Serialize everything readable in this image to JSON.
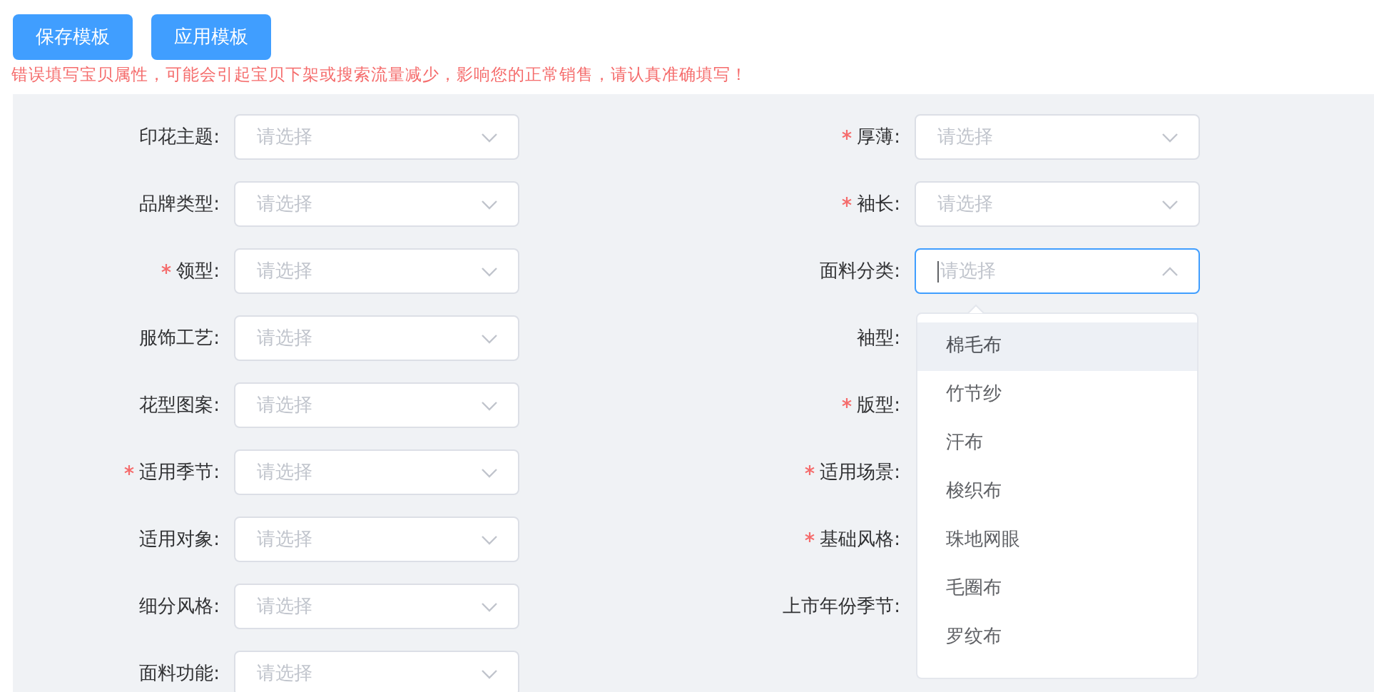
{
  "buttons": [
    "保存模板",
    "应用模板"
  ],
  "warning": "错误填写宝贝属性，可能会引起宝贝下架或搜索流量减少，影响您的正常销售，请认真准确填写！",
  "rows": [
    {
      "left": {
        "label": "印花主题:",
        "required": false,
        "placeholder": "请选择",
        "open": false
      },
      "right": {
        "label": "厚薄:",
        "required": true,
        "placeholder": "请选择",
        "open": false
      }
    },
    {
      "left": {
        "label": "品牌类型:",
        "required": false,
        "placeholder": "请选择",
        "open": false
      },
      "right": {
        "label": "袖长:",
        "required": true,
        "placeholder": "请选择",
        "open": false
      }
    },
    {
      "left": {
        "label": "领型:",
        "required": true,
        "placeholder": "请选择",
        "open": false
      },
      "right": {
        "label": "面料分类:",
        "required": false,
        "placeholder": "请选择",
        "open": true
      }
    },
    {
      "left": {
        "label": "服饰工艺:",
        "required": false,
        "placeholder": "请选择",
        "open": false
      },
      "right": {
        "label": "袖型:",
        "required": false
      }
    },
    {
      "left": {
        "label": "花型图案:",
        "required": false,
        "placeholder": "请选择",
        "open": false
      },
      "right": {
        "label": "版型:",
        "required": true
      }
    },
    {
      "left": {
        "label": "适用季节:",
        "required": true,
        "placeholder": "请选择",
        "open": false
      },
      "right": {
        "label": "适用场景:",
        "required": true
      }
    },
    {
      "left": {
        "label": "适用对象:",
        "required": false,
        "placeholder": "请选择",
        "open": false
      },
      "right": {
        "label": "基础风格:",
        "required": true
      }
    },
    {
      "left": {
        "label": "细分风格:",
        "required": false,
        "placeholder": "请选择",
        "open": false
      },
      "right": {
        "label": "上市年份季节:",
        "required": false
      }
    },
    {
      "left": {
        "label": "面料功能:",
        "required": false,
        "placeholder": "请选择",
        "open": false
      }
    }
  ],
  "dropdown": [
    {
      "label": "棉毛布",
      "highlighted": true
    },
    {
      "label": "竹节纱",
      "highlighted": false
    },
    {
      "label": "汗布",
      "highlighted": false
    },
    {
      "label": "梭织布",
      "highlighted": false
    },
    {
      "label": "珠地网眼",
      "highlighted": false
    },
    {
      "label": "毛圈布",
      "highlighted": false
    },
    {
      "label": "罗纹布",
      "highlighted": false
    }
  ]
}
